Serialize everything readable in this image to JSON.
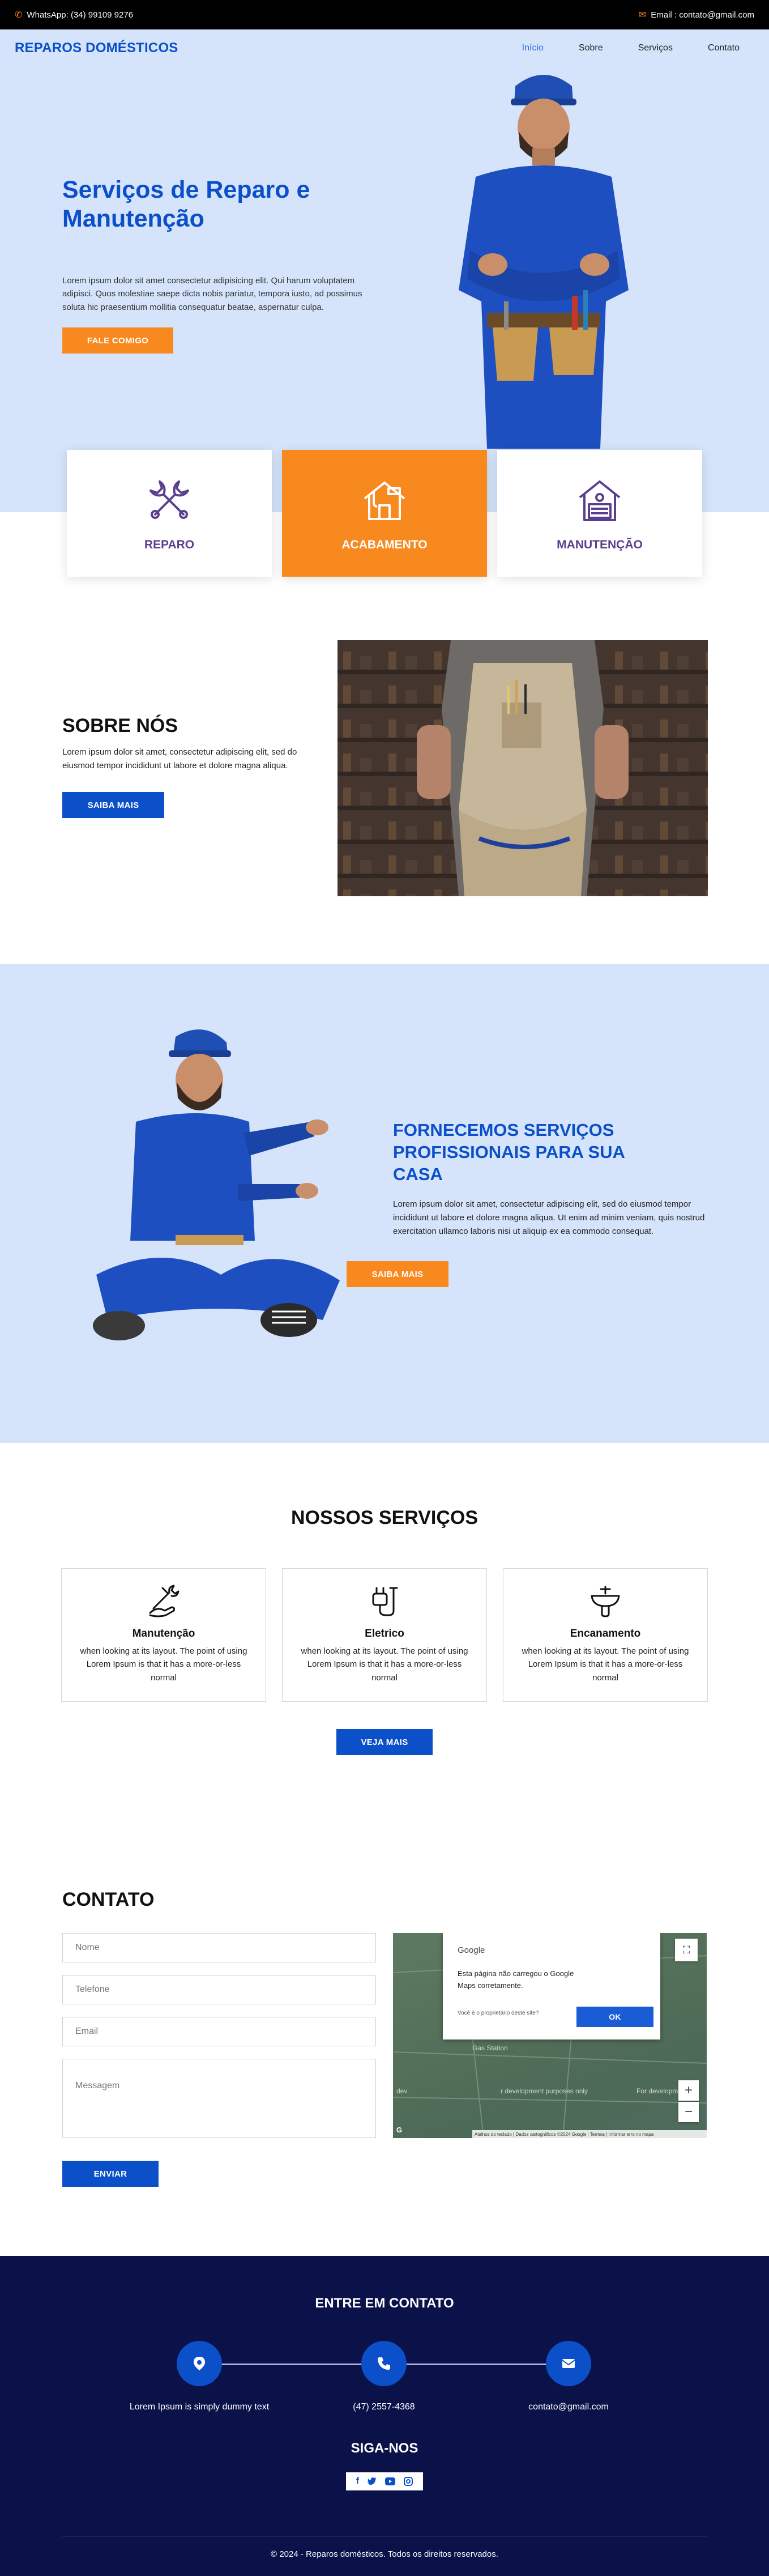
{
  "topbar": {
    "whatsapp": "WhatsApp: (34) 99109 9276",
    "email": "Email : contato@gmail.com"
  },
  "nav": {
    "brand": "REPAROS DOMÉSTICOS",
    "items": [
      "Início",
      "Sobre",
      "Serviços",
      "Contato"
    ],
    "active_index": 0
  },
  "hero": {
    "title": "Serviços de Reparo e Manutenção",
    "text": "Lorem ipsum dolor sit amet consectetur adipisicing elit. Qui harum voluptatem adipisci. Quos molestiae saepe dicta nobis pariatur, tempora iusto, ad possimus soluta hic praesentium mollitia consequatur beatae, aspernatur culpa.",
    "button": "FALE COMIGO"
  },
  "features": [
    {
      "label": "REPARO",
      "icon": "wrench-icon"
    },
    {
      "label": "ACABAMENTO",
      "icon": "paint-house-icon"
    },
    {
      "label": "MANUTENÇÃO",
      "icon": "house-tools-icon"
    }
  ],
  "about": {
    "title": "SOBRE NÓS",
    "text": "Lorem ipsum dolor sit amet, consectetur adipiscing elit, sed do eiusmod tempor incididunt ut labore et dolore magna aliqua.",
    "button": "SAIBA MAIS"
  },
  "pro": {
    "title": "FORNECEMOS SERVIÇOS PROFISSIONAIS PARA SUA CASA",
    "text": "Lorem ipsum dolor sit amet, consectetur adipiscing elit, sed do eiusmod tempor incididunt ut labore et dolore magna aliqua. Ut enim ad minim veniam, quis nostrud exercitation ullamco laboris nisi ut aliquip ex ea commodo consequat.",
    "button": "SAIBA MAIS"
  },
  "services": {
    "title": "NOSSOS SERVIÇOS",
    "items": [
      {
        "title": "Manutenção",
        "text": "when looking at its layout. The point of using Lorem Ipsum is that it has a more-or-less normal"
      },
      {
        "title": "Eletrico",
        "text": "when looking at its layout. The point of using Lorem Ipsum is that it has a more-or-less normal"
      },
      {
        "title": "Encanamento",
        "text": "when looking at its layout. The point of using Lorem Ipsum is that it has a more-or-less normal"
      }
    ],
    "button": "VEJA MAIS"
  },
  "contact": {
    "title": "CONTATO",
    "placeholders": {
      "name": "Nome",
      "phone": "Telefone",
      "email": "Email",
      "message": "Messagem"
    },
    "button": "ENVIAR"
  },
  "map": {
    "dialog_brand": "Google",
    "dialog_text": "Esta página não carregou o Google Maps corretamente.",
    "owner_link": "Você é o proprietário deste site?",
    "ok": "OK",
    "label_1": "Gas Station",
    "label_2": "For developm",
    "label_3": "dev",
    "label_4": "r development purposes only",
    "attribution": "Atalhos do teclado | Dados cartográficos ©2024 Google | Termos | Informar erro no mapa"
  },
  "footer": {
    "title": "ENTRE EM CONTATO",
    "contacts": [
      {
        "icon": "location-pin-icon",
        "text": "Lorem Ipsum is simply dummy text"
      },
      {
        "icon": "phone-icon",
        "text": "(47) 2557-4368"
      },
      {
        "icon": "envelope-icon",
        "text": "contato@gmail.com"
      }
    ],
    "social_title": "SIGA-NOS",
    "copyright": "© 2024 - Reparos domésticos. Todos os direitos reservados."
  },
  "colors": {
    "primary": "#0b4fc9",
    "accent": "#f7891e",
    "light_blue": "#d5e4fb",
    "footer": "#0b1149"
  }
}
